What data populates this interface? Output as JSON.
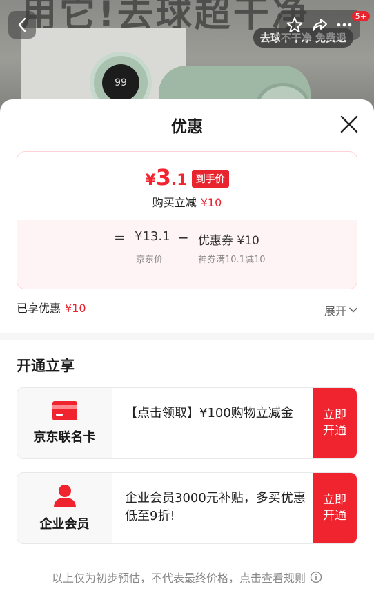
{
  "background": {
    "banner_text": "用它!去球超干净",
    "dial_reading": "99",
    "ad_pill": "去球不干净 免费退",
    "badge": "5+"
  },
  "sheet": {
    "title": "优惠"
  },
  "price_card": {
    "final_currency": "¥",
    "final_int": "3",
    "final_dec": ".1",
    "final_tag": "到手价",
    "buy_minus_label": "购买立减",
    "buy_minus_value": "¥10",
    "equals": "=",
    "jd_price": "¥13.1",
    "jd_label": "京东价",
    "minus": "−",
    "coupon": "优惠券 ¥10",
    "coupon_desc": "神券满10.1减10"
  },
  "enjoyed": {
    "label": "已享优惠",
    "value": "¥10"
  },
  "expand_label": "展开",
  "open_section": {
    "title": "开通立享",
    "offers": [
      {
        "name": "京东联名卡",
        "desc": "【点击领取】¥100购物立减金",
        "cta": "立即开通",
        "icon": "credit-card-icon"
      },
      {
        "name": "企业会员",
        "desc": "企业会员3000元补贴，多买优惠低至9折!",
        "cta": "立即开通",
        "icon": "person-icon"
      }
    ]
  },
  "footnote": "以上仅为初步预估，不代表最终价格，点击查看规则",
  "colors": {
    "accent": "#e8242f",
    "muted": "#888888"
  }
}
